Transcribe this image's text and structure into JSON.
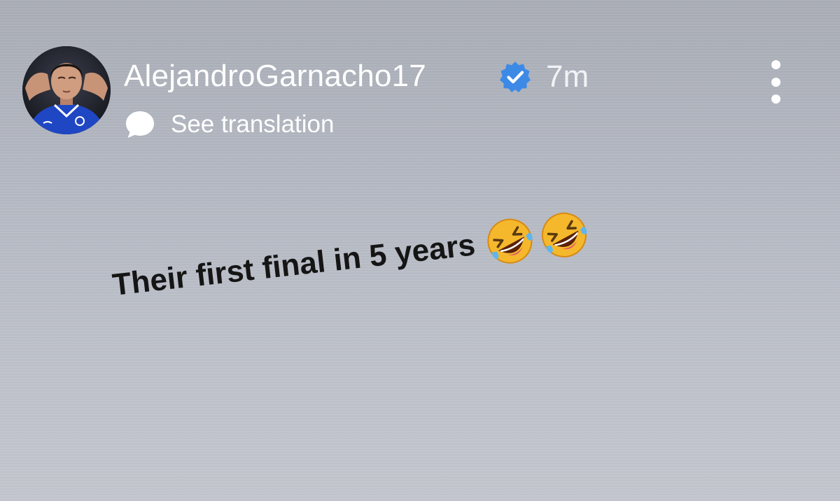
{
  "post": {
    "username": "AlejandroGarnacho17",
    "time_ago": "7m",
    "translate_label": "See translation",
    "caption": "Their first final in 5 years",
    "emojis": [
      "rolling-on-floor-laughing",
      "rolling-on-floor-laughing"
    ]
  },
  "icons": {
    "verified": "verified-badge-icon",
    "translate": "speech-bubble-icon",
    "menu": "more-vertical-icon"
  },
  "colors": {
    "background": "#b4b8c2",
    "header_text": "#ffffff",
    "verified_badge": "#3d8ae6",
    "caption_text": "#151515"
  }
}
